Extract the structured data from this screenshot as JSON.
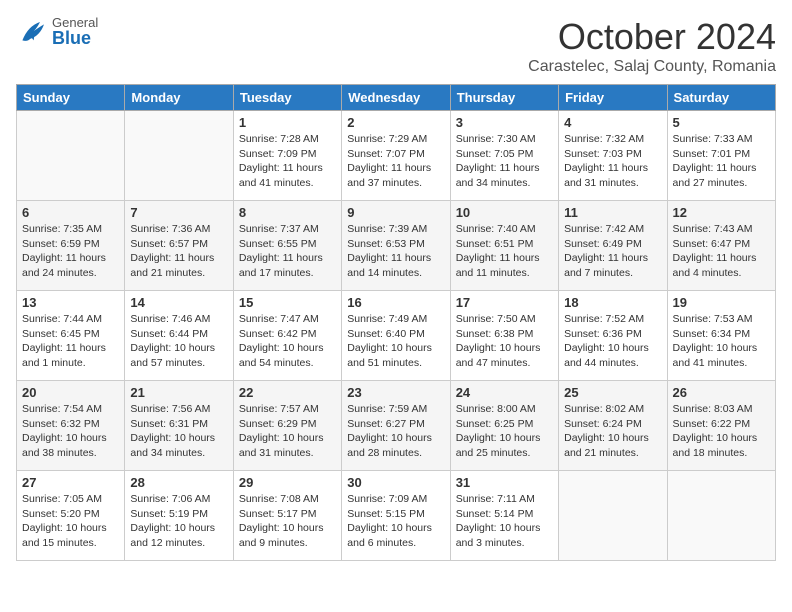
{
  "header": {
    "logo_general": "General",
    "logo_blue": "Blue",
    "month_title": "October 2024",
    "location": "Carastelec, Salaj County, Romania"
  },
  "weekdays": [
    "Sunday",
    "Monday",
    "Tuesday",
    "Wednesday",
    "Thursday",
    "Friday",
    "Saturday"
  ],
  "weeks": [
    [
      {
        "day": "",
        "sunrise": "",
        "sunset": "",
        "daylight": ""
      },
      {
        "day": "",
        "sunrise": "",
        "sunset": "",
        "daylight": ""
      },
      {
        "day": "1",
        "sunrise": "Sunrise: 7:28 AM",
        "sunset": "Sunset: 7:09 PM",
        "daylight": "Daylight: 11 hours and 41 minutes."
      },
      {
        "day": "2",
        "sunrise": "Sunrise: 7:29 AM",
        "sunset": "Sunset: 7:07 PM",
        "daylight": "Daylight: 11 hours and 37 minutes."
      },
      {
        "day": "3",
        "sunrise": "Sunrise: 7:30 AM",
        "sunset": "Sunset: 7:05 PM",
        "daylight": "Daylight: 11 hours and 34 minutes."
      },
      {
        "day": "4",
        "sunrise": "Sunrise: 7:32 AM",
        "sunset": "Sunset: 7:03 PM",
        "daylight": "Daylight: 11 hours and 31 minutes."
      },
      {
        "day": "5",
        "sunrise": "Sunrise: 7:33 AM",
        "sunset": "Sunset: 7:01 PM",
        "daylight": "Daylight: 11 hours and 27 minutes."
      }
    ],
    [
      {
        "day": "6",
        "sunrise": "Sunrise: 7:35 AM",
        "sunset": "Sunset: 6:59 PM",
        "daylight": "Daylight: 11 hours and 24 minutes."
      },
      {
        "day": "7",
        "sunrise": "Sunrise: 7:36 AM",
        "sunset": "Sunset: 6:57 PM",
        "daylight": "Daylight: 11 hours and 21 minutes."
      },
      {
        "day": "8",
        "sunrise": "Sunrise: 7:37 AM",
        "sunset": "Sunset: 6:55 PM",
        "daylight": "Daylight: 11 hours and 17 minutes."
      },
      {
        "day": "9",
        "sunrise": "Sunrise: 7:39 AM",
        "sunset": "Sunset: 6:53 PM",
        "daylight": "Daylight: 11 hours and 14 minutes."
      },
      {
        "day": "10",
        "sunrise": "Sunrise: 7:40 AM",
        "sunset": "Sunset: 6:51 PM",
        "daylight": "Daylight: 11 hours and 11 minutes."
      },
      {
        "day": "11",
        "sunrise": "Sunrise: 7:42 AM",
        "sunset": "Sunset: 6:49 PM",
        "daylight": "Daylight: 11 hours and 7 minutes."
      },
      {
        "day": "12",
        "sunrise": "Sunrise: 7:43 AM",
        "sunset": "Sunset: 6:47 PM",
        "daylight": "Daylight: 11 hours and 4 minutes."
      }
    ],
    [
      {
        "day": "13",
        "sunrise": "Sunrise: 7:44 AM",
        "sunset": "Sunset: 6:45 PM",
        "daylight": "Daylight: 11 hours and 1 minute."
      },
      {
        "day": "14",
        "sunrise": "Sunrise: 7:46 AM",
        "sunset": "Sunset: 6:44 PM",
        "daylight": "Daylight: 10 hours and 57 minutes."
      },
      {
        "day": "15",
        "sunrise": "Sunrise: 7:47 AM",
        "sunset": "Sunset: 6:42 PM",
        "daylight": "Daylight: 10 hours and 54 minutes."
      },
      {
        "day": "16",
        "sunrise": "Sunrise: 7:49 AM",
        "sunset": "Sunset: 6:40 PM",
        "daylight": "Daylight: 10 hours and 51 minutes."
      },
      {
        "day": "17",
        "sunrise": "Sunrise: 7:50 AM",
        "sunset": "Sunset: 6:38 PM",
        "daylight": "Daylight: 10 hours and 47 minutes."
      },
      {
        "day": "18",
        "sunrise": "Sunrise: 7:52 AM",
        "sunset": "Sunset: 6:36 PM",
        "daylight": "Daylight: 10 hours and 44 minutes."
      },
      {
        "day": "19",
        "sunrise": "Sunrise: 7:53 AM",
        "sunset": "Sunset: 6:34 PM",
        "daylight": "Daylight: 10 hours and 41 minutes."
      }
    ],
    [
      {
        "day": "20",
        "sunrise": "Sunrise: 7:54 AM",
        "sunset": "Sunset: 6:32 PM",
        "daylight": "Daylight: 10 hours and 38 minutes."
      },
      {
        "day": "21",
        "sunrise": "Sunrise: 7:56 AM",
        "sunset": "Sunset: 6:31 PM",
        "daylight": "Daylight: 10 hours and 34 minutes."
      },
      {
        "day": "22",
        "sunrise": "Sunrise: 7:57 AM",
        "sunset": "Sunset: 6:29 PM",
        "daylight": "Daylight: 10 hours and 31 minutes."
      },
      {
        "day": "23",
        "sunrise": "Sunrise: 7:59 AM",
        "sunset": "Sunset: 6:27 PM",
        "daylight": "Daylight: 10 hours and 28 minutes."
      },
      {
        "day": "24",
        "sunrise": "Sunrise: 8:00 AM",
        "sunset": "Sunset: 6:25 PM",
        "daylight": "Daylight: 10 hours and 25 minutes."
      },
      {
        "day": "25",
        "sunrise": "Sunrise: 8:02 AM",
        "sunset": "Sunset: 6:24 PM",
        "daylight": "Daylight: 10 hours and 21 minutes."
      },
      {
        "day": "26",
        "sunrise": "Sunrise: 8:03 AM",
        "sunset": "Sunset: 6:22 PM",
        "daylight": "Daylight: 10 hours and 18 minutes."
      }
    ],
    [
      {
        "day": "27",
        "sunrise": "Sunrise: 7:05 AM",
        "sunset": "Sunset: 5:20 PM",
        "daylight": "Daylight: 10 hours and 15 minutes."
      },
      {
        "day": "28",
        "sunrise": "Sunrise: 7:06 AM",
        "sunset": "Sunset: 5:19 PM",
        "daylight": "Daylight: 10 hours and 12 minutes."
      },
      {
        "day": "29",
        "sunrise": "Sunrise: 7:08 AM",
        "sunset": "Sunset: 5:17 PM",
        "daylight": "Daylight: 10 hours and 9 minutes."
      },
      {
        "day": "30",
        "sunrise": "Sunrise: 7:09 AM",
        "sunset": "Sunset: 5:15 PM",
        "daylight": "Daylight: 10 hours and 6 minutes."
      },
      {
        "day": "31",
        "sunrise": "Sunrise: 7:11 AM",
        "sunset": "Sunset: 5:14 PM",
        "daylight": "Daylight: 10 hours and 3 minutes."
      },
      {
        "day": "",
        "sunrise": "",
        "sunset": "",
        "daylight": ""
      },
      {
        "day": "",
        "sunrise": "",
        "sunset": "",
        "daylight": ""
      }
    ]
  ]
}
